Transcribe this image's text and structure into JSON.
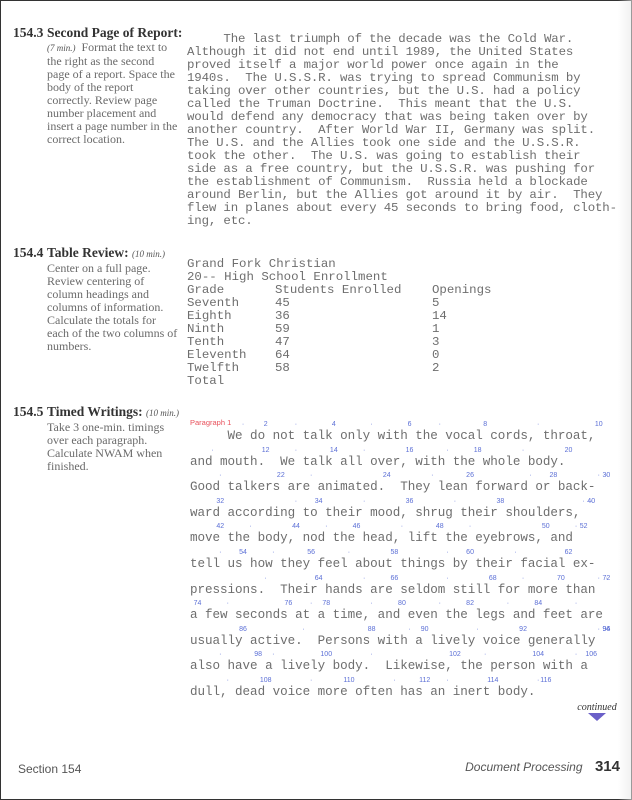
{
  "exercises": [
    {
      "number": "154.3",
      "title": "Second Page of Report:",
      "time": "(7 min.)",
      "description": "Format the text to the right as the second page of a report.  Space the body of the report correctly.  Review page number placement and insert a page number in the correct location."
    },
    {
      "number": "154.4",
      "title": "Table Review:",
      "time": "(10 min.)",
      "description": "Center on a full page. Review centering of column headings and columns of information. Calculate the totals for each of the two columns of numbers."
    },
    {
      "number": "154.5",
      "title": "Timed Writings:",
      "time": "(10 min.)",
      "description": "Take 3 one-min. timings over each paragraph. Calculate NWAM when finished."
    }
  ],
  "report_lines": [
    "     The last triumph of the decade was the Cold War.",
    "Although it did not end until 1989, the United States",
    "proved itself a major world power once again in the",
    "1940s.  The U.S.S.R. was trying to spread Communism by",
    "taking over other countries, but the U.S. had a policy",
    "called the Truman Doctrine.  This meant that the U.S.",
    "would defend any democracy that was being taken over by",
    "another country.  After World War II, Germany was split.",
    "The U.S. and the Allies took one side and the U.S.S.R.",
    "took the other.  The U.S. was going to establish their",
    "side as a free country, but the U.S.S.R. was pushing for",
    "the establishment of Communism.  Russia held a blockade",
    "around Berlin, but the Allies got around it by air.  They",
    "flew in planes about every 45 seconds to bring food, cloth-",
    "ing, etc."
  ],
  "table": {
    "title": "Grand Fork Christian",
    "subtitle": "20-- High School Enrollment",
    "headers": [
      "Grade",
      "Students Enrolled",
      "Openings"
    ],
    "rows": [
      [
        "Seventh",
        "45",
        "5"
      ],
      [
        "Eighth",
        "36",
        "14"
      ],
      [
        "Ninth",
        "59",
        "1"
      ],
      [
        "Tenth",
        "47",
        "3"
      ],
      [
        "Eleventh",
        "64",
        "0"
      ],
      [
        "Twelfth",
        "58",
        "2"
      ]
    ],
    "total_label": "Total"
  },
  "timed_writing": {
    "label": "Paragraph 1",
    "lines": [
      {
        "text": "     We do not talk only with the vocal cords, throat,",
        "markers": [
          "·",
          "2",
          "·",
          "4",
          "·",
          "6",
          "·",
          "8",
          "·",
          "10"
        ]
      },
      {
        "text": "and mouth.  We talk all over, with the whole body.",
        "markers": [
          "·",
          "12",
          "·",
          "14",
          "·",
          "16",
          "·",
          "18",
          "·",
          "20"
        ]
      },
      {
        "text": "Good talkers are animated.  They lean forward or back-",
        "markers": [
          "·",
          "22",
          "·",
          "24",
          "·",
          "26",
          "·",
          "28",
          "·",
          "30",
          "·"
        ]
      },
      {
        "text": "ward according to their mood, shrug their shoulders,",
        "markers": [
          "32",
          "·",
          "34",
          "·",
          "36",
          "·",
          "38",
          "·",
          "40",
          "·"
        ]
      },
      {
        "text": "move the body, nod the head, lift the eyebrows, and",
        "markers": [
          "42",
          "·",
          "44",
          "·",
          "46",
          "·",
          "48",
          "·",
          "50",
          "·",
          "52"
        ]
      },
      {
        "text": "tell us how they feel about things by their facial ex-",
        "markers": [
          "·",
          "54",
          "·",
          "56",
          "·",
          "58",
          "·",
          "60",
          "·",
          "62"
        ]
      },
      {
        "text": "pressions.  Their hands are seldom still for more than",
        "markers": [
          "·",
          "64",
          "·",
          "66",
          "·",
          "68",
          "·",
          "70",
          "·",
          "72",
          "·"
        ]
      },
      {
        "text": "a few seconds at a time, and even the legs and feet are",
        "markers": [
          "74",
          "·",
          "76",
          "·",
          "78",
          "·",
          "80",
          "·",
          "82",
          "·",
          "84",
          "·"
        ]
      },
      {
        "text": "usually active.  Persons with a lively voice generally",
        "markers": [
          "86",
          "·",
          "88",
          "·",
          "90",
          "·",
          "92",
          "·",
          "94",
          "·",
          "96"
        ]
      },
      {
        "text": "also have a lively body.  Likewise, the person with a",
        "markers": [
          "·",
          "98",
          "·",
          "100",
          "·",
          "102",
          "·",
          "104",
          "·",
          "106"
        ]
      },
      {
        "text": "dull, dead voice more often has an inert body.",
        "markers": [
          "·",
          "108",
          "·",
          "110",
          "·",
          "112",
          "·",
          "114",
          "·",
          "116"
        ]
      }
    ]
  },
  "continued_label": "continued",
  "footer": {
    "section": "Section 154",
    "chapter": "Document Processing",
    "page_number": "314"
  },
  "colors": {
    "marker_blue": "#5b6fd6",
    "paragraph_label_red": "#e8505b",
    "arrow_purple": "#6a5fc8"
  }
}
